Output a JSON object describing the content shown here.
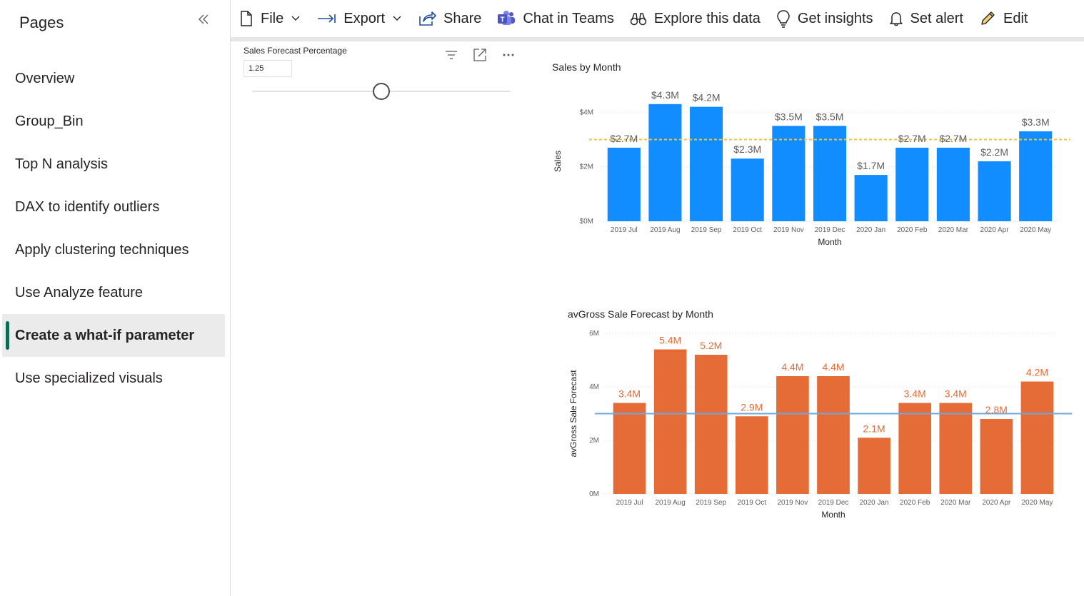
{
  "sidebar": {
    "title": "Pages",
    "items": [
      {
        "label": "Overview",
        "active": false
      },
      {
        "label": "Group_Bin",
        "active": false
      },
      {
        "label": "Top N analysis",
        "active": false
      },
      {
        "label": "DAX to identify outliers",
        "active": false
      },
      {
        "label": "Apply clustering techniques",
        "active": false
      },
      {
        "label": "Use Analyze feature",
        "active": false
      },
      {
        "label": "Create a what-if parameter",
        "active": true
      },
      {
        "label": "Use specialized visuals",
        "active": false
      }
    ]
  },
  "toolbar": {
    "file": "File",
    "export": "Export",
    "share": "Share",
    "chat": "Chat in Teams",
    "explore": "Explore this data",
    "insights": "Get insights",
    "alert": "Set alert",
    "edit": "Edit"
  },
  "slicer": {
    "title": "Sales Forecast Percentage",
    "value": "1.25",
    "position_fraction": 0.5
  },
  "colors": {
    "sales_bar": "#118dff",
    "forecast_bar": "#e66c37",
    "sales_line": "#e8c547",
    "forecast_line": "#6fa8dc",
    "accent": "#0e6b57"
  },
  "chart_data": [
    {
      "type": "bar",
      "title": "Sales by Month",
      "xlabel": "Month",
      "ylabel": "Sales",
      "categories": [
        "2019 Jul",
        "2019 Aug",
        "2019 Sep",
        "2019 Oct",
        "2019 Nov",
        "2019 Dec",
        "2020 Jan",
        "2020 Feb",
        "2020 Mar",
        "2020 Apr",
        "2020 May"
      ],
      "values": [
        2.7,
        4.3,
        4.2,
        2.3,
        3.5,
        3.5,
        1.7,
        2.7,
        2.7,
        2.2,
        3.3
      ],
      "data_labels": [
        "$2.7M",
        "$4.3M",
        "$4.2M",
        "$2.3M",
        "$3.5M",
        "$3.5M",
        "$1.7M",
        "$2.7M",
        "$2.7M",
        "$2.2M",
        "$3.3M"
      ],
      "yticks": [
        0,
        2,
        4
      ],
      "ytick_labels": [
        "$0M",
        "$2M",
        "$4M"
      ],
      "ylim": [
        0,
        4.4
      ],
      "reference_line": 3.0,
      "grid": true
    },
    {
      "type": "bar",
      "title": "avGross Sale Forecast by Month",
      "xlabel": "Month",
      "ylabel": "avGross Sale Forecast",
      "categories": [
        "2019 Jul",
        "2019 Aug",
        "2019 Sep",
        "2019 Oct",
        "2019 Nov",
        "2019 Dec",
        "2020 Jan",
        "2020 Feb",
        "2020 Mar",
        "2020 Apr",
        "2020 May"
      ],
      "values": [
        3.4,
        5.4,
        5.2,
        2.9,
        4.4,
        4.4,
        2.1,
        3.4,
        3.4,
        2.8,
        4.2
      ],
      "data_labels": [
        "3.4M",
        "5.4M",
        "5.2M",
        "2.9M",
        "4.4M",
        "4.4M",
        "2.1M",
        "3.4M",
        "3.4M",
        "2.8M",
        "4.2M"
      ],
      "yticks": [
        0,
        2,
        4,
        6
      ],
      "ytick_labels": [
        "0M",
        "2M",
        "4M",
        "6M"
      ],
      "ylim": [
        0,
        6
      ],
      "reference_line": 3.0,
      "grid": true
    }
  ]
}
